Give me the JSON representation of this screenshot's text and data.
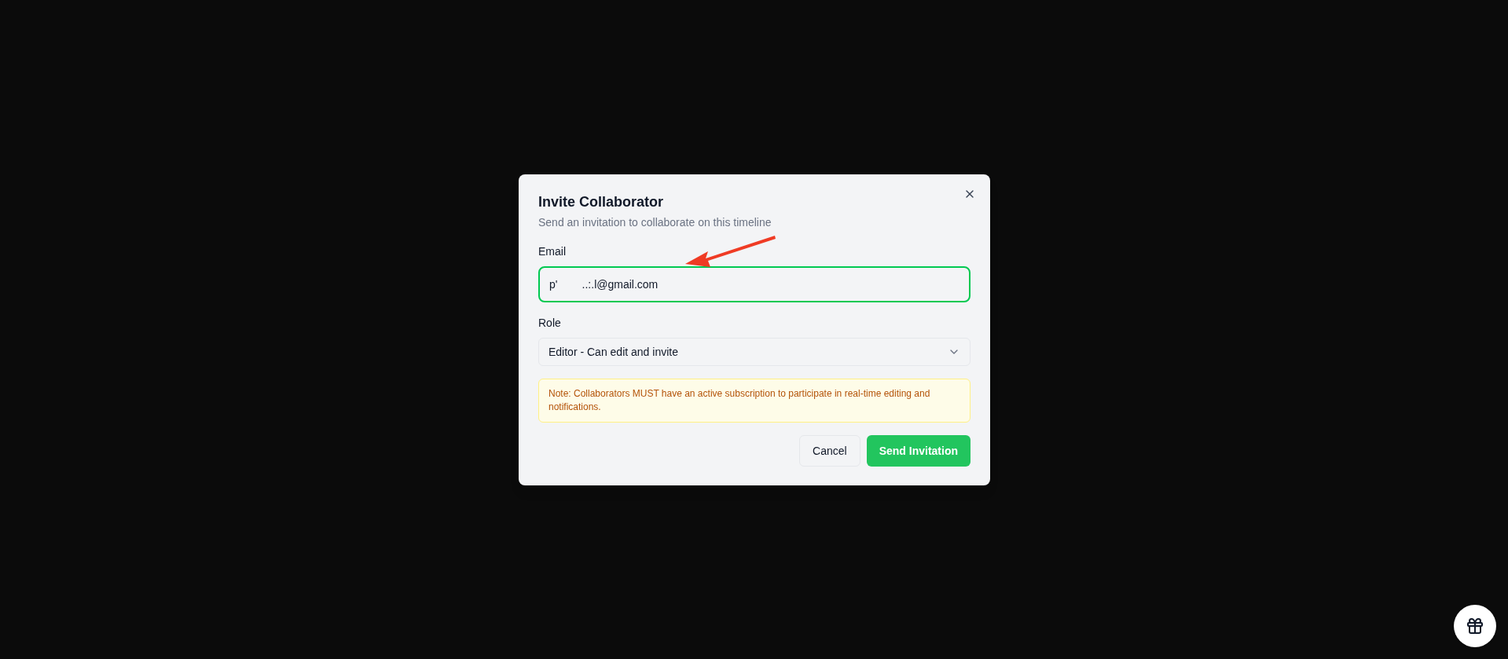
{
  "dialog": {
    "title": "Invite Collaborator",
    "subtitle": "Send an invitation to collaborate on this timeline",
    "email_label": "Email",
    "email_value": "p'        ..:.l@gmail.com",
    "role_label": "Role",
    "role_value": "Editor - Can edit and invite",
    "note": "Note: Collaborators MUST have an active subscription to participate in real-time editing and notifications.",
    "buttons": [
      {
        "label": "Cancel",
        "kind": "secondary"
      },
      {
        "label": "Send Invitation",
        "kind": "primary"
      }
    ]
  }
}
